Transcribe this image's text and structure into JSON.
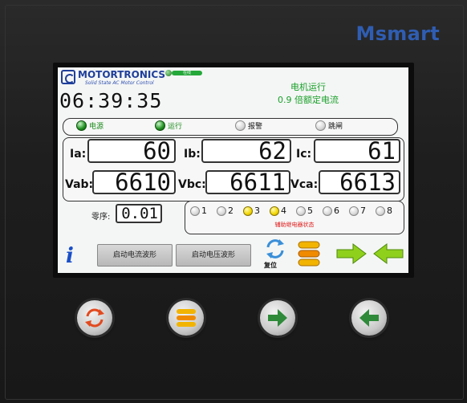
{
  "panel": {
    "brand": "Msmart"
  },
  "screen": {
    "logo": {
      "name": "MOTORTRONICS",
      "tagline": "Solid State AC Motor Control"
    },
    "network_indicator": {
      "label": "在线",
      "state": "on"
    },
    "clock": "06:39:35",
    "status": {
      "line1": "电机运行",
      "line2": "0.9 倍额定电流"
    },
    "indicators": [
      {
        "label": "电源",
        "state": "on",
        "color": "green"
      },
      {
        "label": "运行",
        "state": "on",
        "color": "green"
      },
      {
        "label": "报警",
        "state": "off",
        "color": "black"
      },
      {
        "label": "跳闸",
        "state": "off",
        "color": "black"
      }
    ],
    "meters": {
      "ia": {
        "label": "Ia:",
        "value": "60"
      },
      "ib": {
        "label": "Ib:",
        "value": "62"
      },
      "ic": {
        "label": "Ic:",
        "value": "61"
      },
      "vab": {
        "label": "Vab:",
        "value": "6610"
      },
      "vbc": {
        "label": "Vbc:",
        "value": "6611"
      },
      "vca": {
        "label": "Vca:",
        "value": "6613"
      }
    },
    "sequence": {
      "label": "零序:",
      "value": "0.01"
    },
    "relays": {
      "items": [
        {
          "num": "1",
          "state": "off"
        },
        {
          "num": "2",
          "state": "off"
        },
        {
          "num": "3",
          "state": "on"
        },
        {
          "num": "4",
          "state": "on"
        },
        {
          "num": "5",
          "state": "off"
        },
        {
          "num": "6",
          "state": "off"
        },
        {
          "num": "7",
          "state": "off"
        },
        {
          "num": "8",
          "state": "off"
        }
      ],
      "caption": "辅助继电器状态"
    },
    "buttons": {
      "current_wave": "启动电流波形",
      "voltage_wave": "启动电压波形",
      "reset": "复位"
    },
    "icons": {
      "info": "info-icon",
      "reset": "reset-icon",
      "menu": "menu-stack-icon",
      "next": "arrow-right-icon",
      "back": "arrow-left-icon"
    },
    "colors": {
      "accent_green": "#1aa02a",
      "relay_caption": "#e02020",
      "info_blue": "#1a4fc8",
      "brand_blue": "#2f5db2"
    }
  },
  "hardware_buttons": [
    {
      "icon": "reset-icon"
    },
    {
      "icon": "menu-stack-icon"
    },
    {
      "icon": "arrow-right-icon"
    },
    {
      "icon": "arrow-left-icon"
    }
  ]
}
